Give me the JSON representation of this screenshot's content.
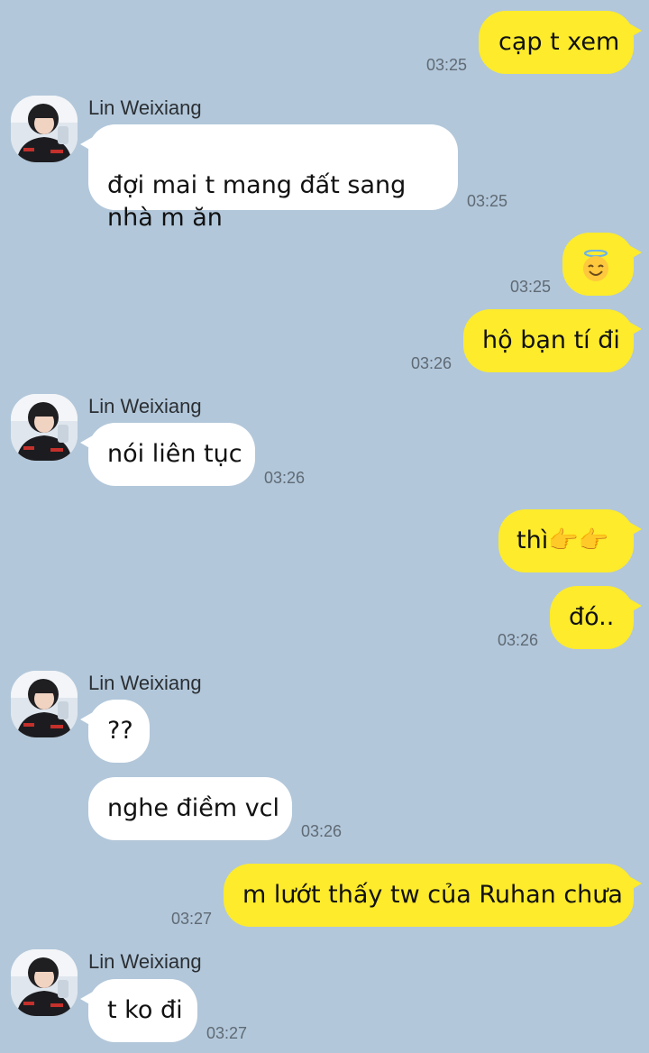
{
  "conversation": {
    "contact_name": "Lin Weixiang",
    "messages": [
      {
        "id": "m1",
        "from": "me",
        "text": "cạp t xem",
        "time": "03:25"
      },
      {
        "id": "m2",
        "from": "them",
        "text": "đợi mai t mang đất sang\nnhà m ăn",
        "time": "03:25"
      },
      {
        "id": "m3",
        "from": "me",
        "text": "😇",
        "time": "03:25",
        "icon": "smiling-face-with-halo-icon"
      },
      {
        "id": "m4",
        "from": "me",
        "text": "hộ bạn tí đi",
        "time": "03:26"
      },
      {
        "id": "m5",
        "from": "them",
        "text": "nói liên tục",
        "time": "03:26"
      },
      {
        "id": "m6",
        "from": "me",
        "text": "thì👉👉",
        "time": "",
        "icon": "pointing-right-hands-icon"
      },
      {
        "id": "m7",
        "from": "me",
        "text": "đó..",
        "time": "03:26"
      },
      {
        "id": "m8",
        "from": "them",
        "text": "??",
        "time": ""
      },
      {
        "id": "m9",
        "from": "them",
        "text": "nghe điềm vcl",
        "time": "03:26"
      },
      {
        "id": "m10",
        "from": "me",
        "text": "m lướt thấy tw của Ruhan chưa",
        "time": "03:27"
      },
      {
        "id": "m11",
        "from": "them",
        "text": "t ko đi",
        "time": "03:27"
      }
    ]
  },
  "colors": {
    "background": "#b2c7da",
    "my_bubble": "#fdeb2c",
    "their_bubble": "#ffffff",
    "timestamp": "#5f6a74"
  }
}
